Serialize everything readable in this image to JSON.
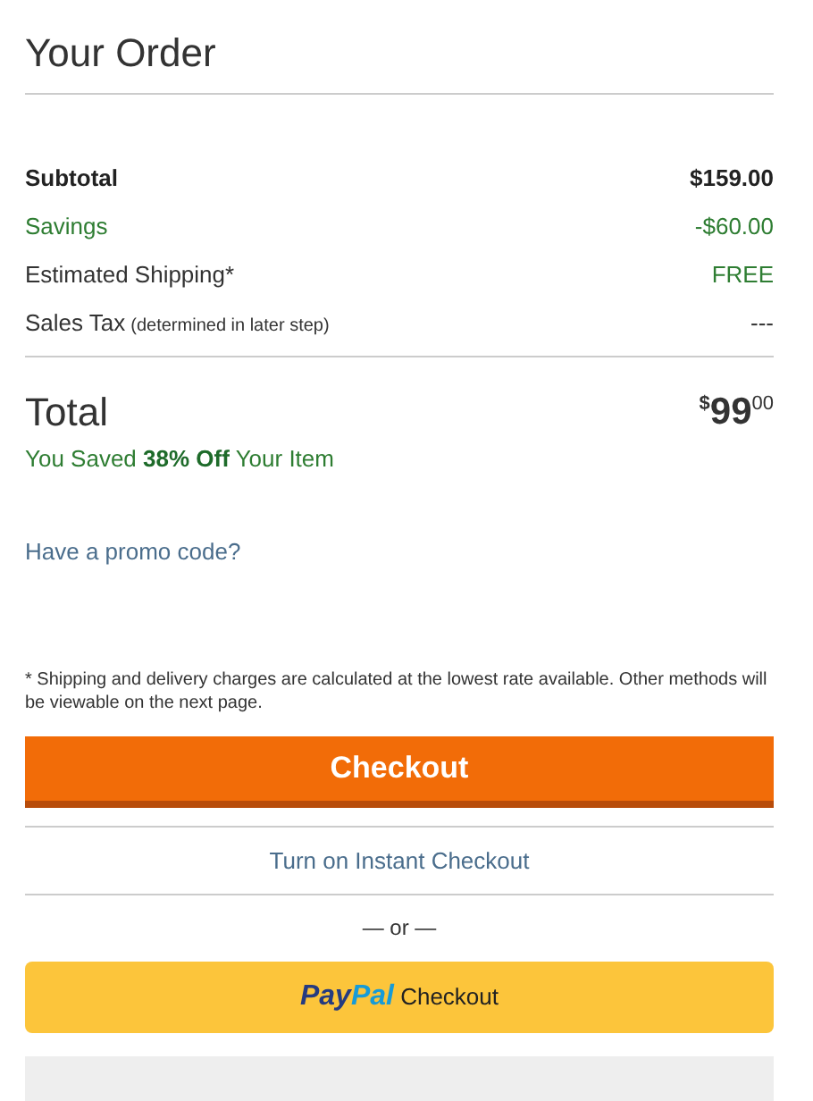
{
  "title": "Your Order",
  "summary": [
    {
      "kind": "bold",
      "label": "Subtotal",
      "value": "$159.00"
    },
    {
      "kind": "green",
      "label": "Savings",
      "value": "-$60.00"
    },
    {
      "kind": "plain-green-value",
      "label": "Estimated Shipping*",
      "value": "FREE"
    },
    {
      "kind": "plain",
      "label": "Sales Tax",
      "note": "(determined in later step)",
      "value": "---"
    }
  ],
  "total": {
    "label": "Total",
    "currency": "$",
    "whole": "99",
    "cents": "00"
  },
  "savings_message": "You Saved **38% Off** Your Item",
  "promo_link": "Have a promo code?",
  "shipping_note": "* Shipping and delivery charges are calculated at the lowest rate available. Other methods will be viewable on the next page.",
  "checkout_button": "Checkout",
  "instant_checkout_link": "Turn on Instant Checkout",
  "separator": "— or —",
  "paypal_button": {
    "logo_part_1": "Pay",
    "logo_part_2": "Pal",
    "label": "Checkout"
  }
}
